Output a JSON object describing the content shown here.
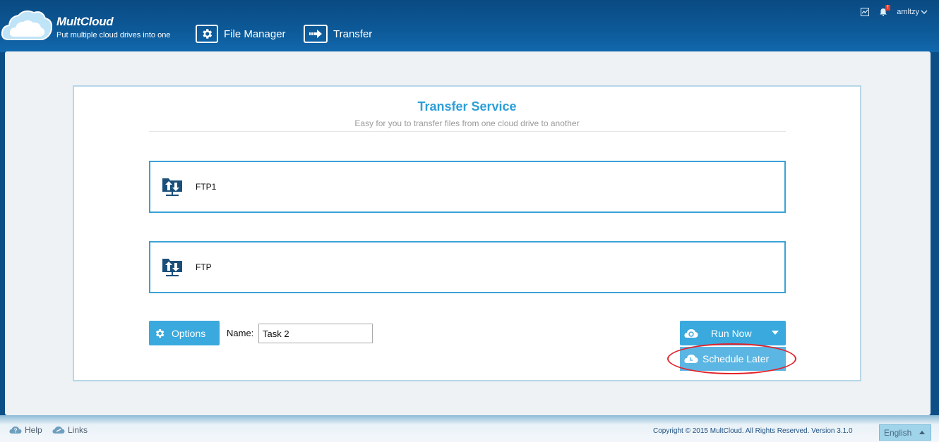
{
  "header": {
    "logo_title": "MultCloud",
    "tagline": "Put multiple cloud drives into one",
    "nav": [
      {
        "label": "File Manager",
        "icon": "gear-icon"
      },
      {
        "label": "Transfer",
        "icon": "arrow-right-icon"
      }
    ],
    "notification_badge": "!",
    "username": "amltzy"
  },
  "card": {
    "title": "Transfer Service",
    "subtitle": "Easy for you to transfer files from one cloud drive to another",
    "source_drive": {
      "label": "FTP1",
      "icon": "ftp-folder-icon"
    },
    "target_drive": {
      "label": "FTP",
      "icon": "ftp-folder-icon"
    },
    "options_label": "Options",
    "name_label": "Name:",
    "task_name": "Task 2",
    "run_now_label": "Run Now",
    "schedule_label": "Schedule Later"
  },
  "footer": {
    "help_label": "Help",
    "links_label": "Links",
    "copyright": "Copyright © 2015 MultCloud. All Rights Reserved. Version 3.1.0",
    "language": "English"
  },
  "colors": {
    "header_bg": "#0d5a99",
    "accent": "#3aa9de",
    "title": "#2d9fd6",
    "highlight": "#e0242c"
  }
}
